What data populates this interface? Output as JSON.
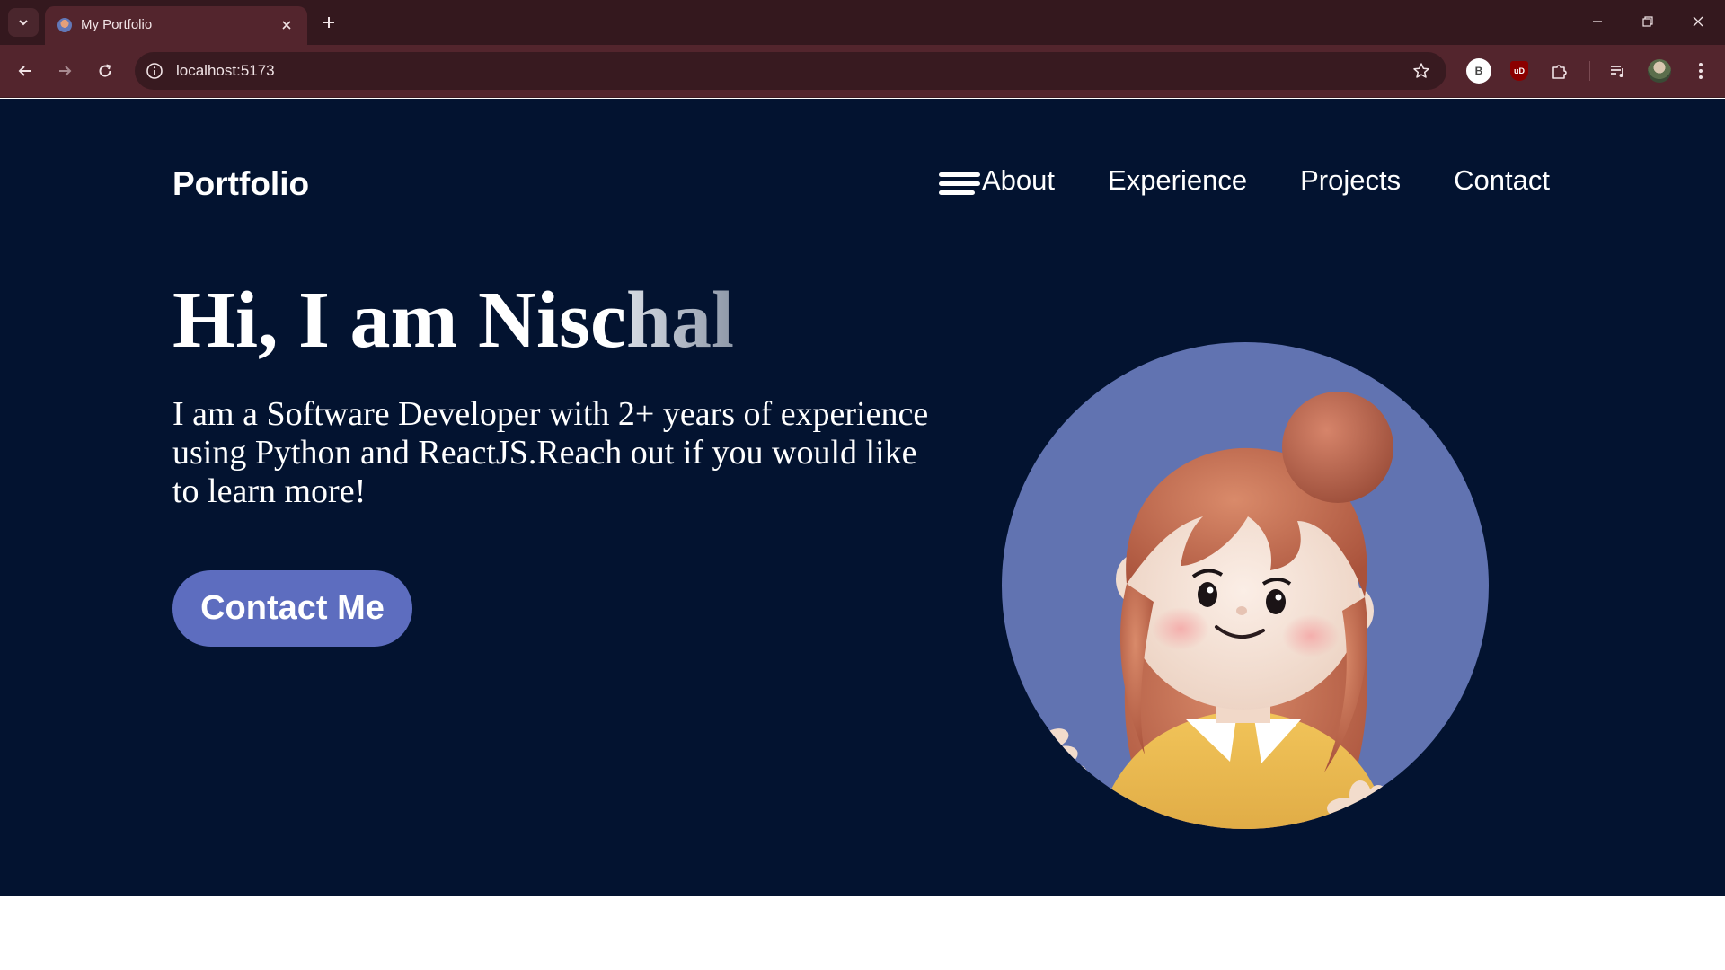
{
  "browser": {
    "tab": {
      "title": "My Portfolio"
    },
    "address_bar": {
      "url": "localhost:5173"
    },
    "extensions": {
      "b_badge": "B",
      "ublock_badge": "uD"
    }
  },
  "header": {
    "logo": "Portfolio",
    "nav": [
      "About",
      "Experience",
      "Projects",
      "Contact"
    ]
  },
  "hero": {
    "title_solid": "Hi, I am Nisc",
    "title_fade": "hal",
    "description": "I am a Software Developer with 2+ years of experience using Python and ReactJS.Reach out if you would like to learn more!",
    "cta_label": "Contact Me"
  },
  "colors": {
    "page_background": "#031330",
    "accent": "#5d6dbf",
    "browser_frame": "#34181e",
    "browser_toolbar": "#53252d"
  }
}
